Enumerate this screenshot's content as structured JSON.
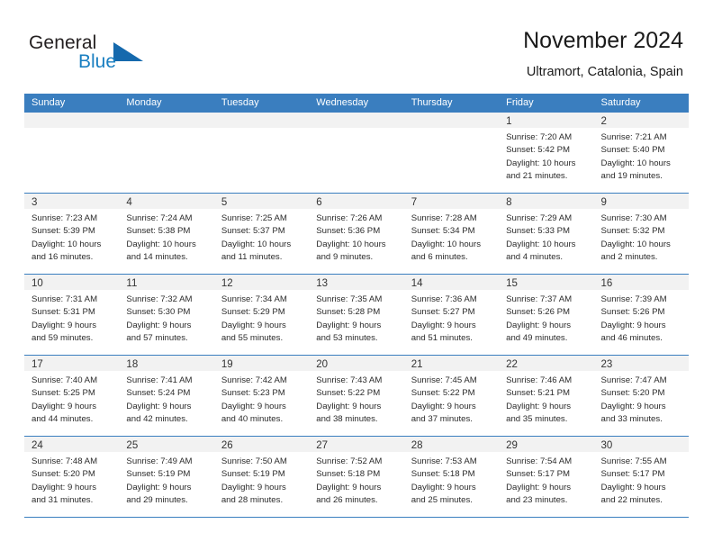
{
  "brand": {
    "word_one": "General",
    "word_two": "Blue",
    "accent_color": "#1569ad",
    "text_color": "#231f20"
  },
  "header": {
    "title": "November 2024",
    "subtitle": "Ultramort, Catalonia, Spain"
  },
  "theme": {
    "header_blue": "#3a7ebf",
    "day_band_gray": "#f2f2f2",
    "text": "#2b2b2b"
  },
  "weekdays": [
    "Sunday",
    "Monday",
    "Tuesday",
    "Wednesday",
    "Thursday",
    "Friday",
    "Saturday"
  ],
  "weeks": [
    [
      {
        "day": "",
        "lines": []
      },
      {
        "day": "",
        "lines": []
      },
      {
        "day": "",
        "lines": []
      },
      {
        "day": "",
        "lines": []
      },
      {
        "day": "",
        "lines": []
      },
      {
        "day": "1",
        "lines": [
          "Sunrise: 7:20 AM",
          "Sunset: 5:42 PM",
          "Daylight: 10 hours",
          "and 21 minutes."
        ]
      },
      {
        "day": "2",
        "lines": [
          "Sunrise: 7:21 AM",
          "Sunset: 5:40 PM",
          "Daylight: 10 hours",
          "and 19 minutes."
        ]
      }
    ],
    [
      {
        "day": "3",
        "lines": [
          "Sunrise: 7:23 AM",
          "Sunset: 5:39 PM",
          "Daylight: 10 hours",
          "and 16 minutes."
        ]
      },
      {
        "day": "4",
        "lines": [
          "Sunrise: 7:24 AM",
          "Sunset: 5:38 PM",
          "Daylight: 10 hours",
          "and 14 minutes."
        ]
      },
      {
        "day": "5",
        "lines": [
          "Sunrise: 7:25 AM",
          "Sunset: 5:37 PM",
          "Daylight: 10 hours",
          "and 11 minutes."
        ]
      },
      {
        "day": "6",
        "lines": [
          "Sunrise: 7:26 AM",
          "Sunset: 5:36 PM",
          "Daylight: 10 hours",
          "and 9 minutes."
        ]
      },
      {
        "day": "7",
        "lines": [
          "Sunrise: 7:28 AM",
          "Sunset: 5:34 PM",
          "Daylight: 10 hours",
          "and 6 minutes."
        ]
      },
      {
        "day": "8",
        "lines": [
          "Sunrise: 7:29 AM",
          "Sunset: 5:33 PM",
          "Daylight: 10 hours",
          "and 4 minutes."
        ]
      },
      {
        "day": "9",
        "lines": [
          "Sunrise: 7:30 AM",
          "Sunset: 5:32 PM",
          "Daylight: 10 hours",
          "and 2 minutes."
        ]
      }
    ],
    [
      {
        "day": "10",
        "lines": [
          "Sunrise: 7:31 AM",
          "Sunset: 5:31 PM",
          "Daylight: 9 hours",
          "and 59 minutes."
        ]
      },
      {
        "day": "11",
        "lines": [
          "Sunrise: 7:32 AM",
          "Sunset: 5:30 PM",
          "Daylight: 9 hours",
          "and 57 minutes."
        ]
      },
      {
        "day": "12",
        "lines": [
          "Sunrise: 7:34 AM",
          "Sunset: 5:29 PM",
          "Daylight: 9 hours",
          "and 55 minutes."
        ]
      },
      {
        "day": "13",
        "lines": [
          "Sunrise: 7:35 AM",
          "Sunset: 5:28 PM",
          "Daylight: 9 hours",
          "and 53 minutes."
        ]
      },
      {
        "day": "14",
        "lines": [
          "Sunrise: 7:36 AM",
          "Sunset: 5:27 PM",
          "Daylight: 9 hours",
          "and 51 minutes."
        ]
      },
      {
        "day": "15",
        "lines": [
          "Sunrise: 7:37 AM",
          "Sunset: 5:26 PM",
          "Daylight: 9 hours",
          "and 49 minutes."
        ]
      },
      {
        "day": "16",
        "lines": [
          "Sunrise: 7:39 AM",
          "Sunset: 5:26 PM",
          "Daylight: 9 hours",
          "and 46 minutes."
        ]
      }
    ],
    [
      {
        "day": "17",
        "lines": [
          "Sunrise: 7:40 AM",
          "Sunset: 5:25 PM",
          "Daylight: 9 hours",
          "and 44 minutes."
        ]
      },
      {
        "day": "18",
        "lines": [
          "Sunrise: 7:41 AM",
          "Sunset: 5:24 PM",
          "Daylight: 9 hours",
          "and 42 minutes."
        ]
      },
      {
        "day": "19",
        "lines": [
          "Sunrise: 7:42 AM",
          "Sunset: 5:23 PM",
          "Daylight: 9 hours",
          "and 40 minutes."
        ]
      },
      {
        "day": "20",
        "lines": [
          "Sunrise: 7:43 AM",
          "Sunset: 5:22 PM",
          "Daylight: 9 hours",
          "and 38 minutes."
        ]
      },
      {
        "day": "21",
        "lines": [
          "Sunrise: 7:45 AM",
          "Sunset: 5:22 PM",
          "Daylight: 9 hours",
          "and 37 minutes."
        ]
      },
      {
        "day": "22",
        "lines": [
          "Sunrise: 7:46 AM",
          "Sunset: 5:21 PM",
          "Daylight: 9 hours",
          "and 35 minutes."
        ]
      },
      {
        "day": "23",
        "lines": [
          "Sunrise: 7:47 AM",
          "Sunset: 5:20 PM",
          "Daylight: 9 hours",
          "and 33 minutes."
        ]
      }
    ],
    [
      {
        "day": "24",
        "lines": [
          "Sunrise: 7:48 AM",
          "Sunset: 5:20 PM",
          "Daylight: 9 hours",
          "and 31 minutes."
        ]
      },
      {
        "day": "25",
        "lines": [
          "Sunrise: 7:49 AM",
          "Sunset: 5:19 PM",
          "Daylight: 9 hours",
          "and 29 minutes."
        ]
      },
      {
        "day": "26",
        "lines": [
          "Sunrise: 7:50 AM",
          "Sunset: 5:19 PM",
          "Daylight: 9 hours",
          "and 28 minutes."
        ]
      },
      {
        "day": "27",
        "lines": [
          "Sunrise: 7:52 AM",
          "Sunset: 5:18 PM",
          "Daylight: 9 hours",
          "and 26 minutes."
        ]
      },
      {
        "day": "28",
        "lines": [
          "Sunrise: 7:53 AM",
          "Sunset: 5:18 PM",
          "Daylight: 9 hours",
          "and 25 minutes."
        ]
      },
      {
        "day": "29",
        "lines": [
          "Sunrise: 7:54 AM",
          "Sunset: 5:17 PM",
          "Daylight: 9 hours",
          "and 23 minutes."
        ]
      },
      {
        "day": "30",
        "lines": [
          "Sunrise: 7:55 AM",
          "Sunset: 5:17 PM",
          "Daylight: 9 hours",
          "and 22 minutes."
        ]
      }
    ]
  ]
}
